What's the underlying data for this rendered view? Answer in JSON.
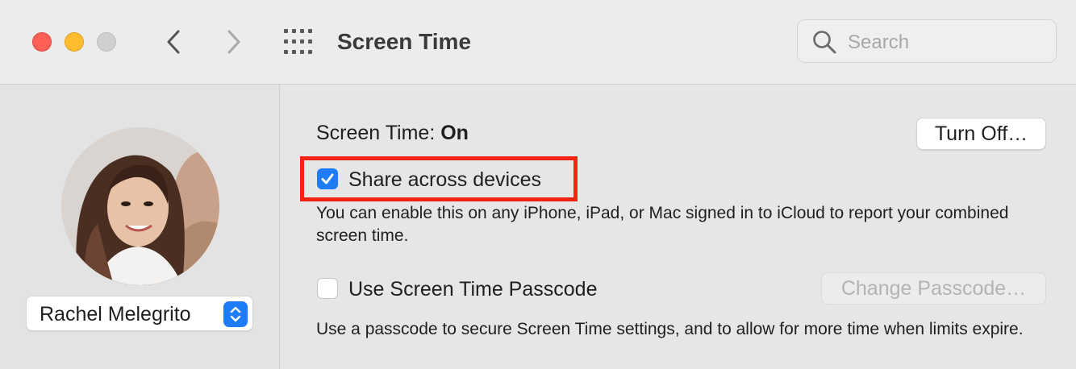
{
  "window": {
    "title": "Screen Time",
    "search_placeholder": "Search"
  },
  "sidebar": {
    "user_name": "Rachel Melegrito"
  },
  "main": {
    "status_label": "Screen Time: ",
    "status_value": "On",
    "turn_off_label": "Turn Off…",
    "share_label": "Share across devices",
    "share_checked": true,
    "share_description": "You can enable this on any iPhone, iPad, or Mac signed in to iCloud to report your combined screen time.",
    "passcode_label": "Use Screen Time Passcode",
    "passcode_checked": false,
    "change_passcode_label": "Change Passcode…",
    "passcode_description": "Use a passcode to secure Screen Time settings, and to allow for more time when limits expire."
  },
  "colors": {
    "accent": "#1d7cf6",
    "highlight": "#f5230f"
  }
}
